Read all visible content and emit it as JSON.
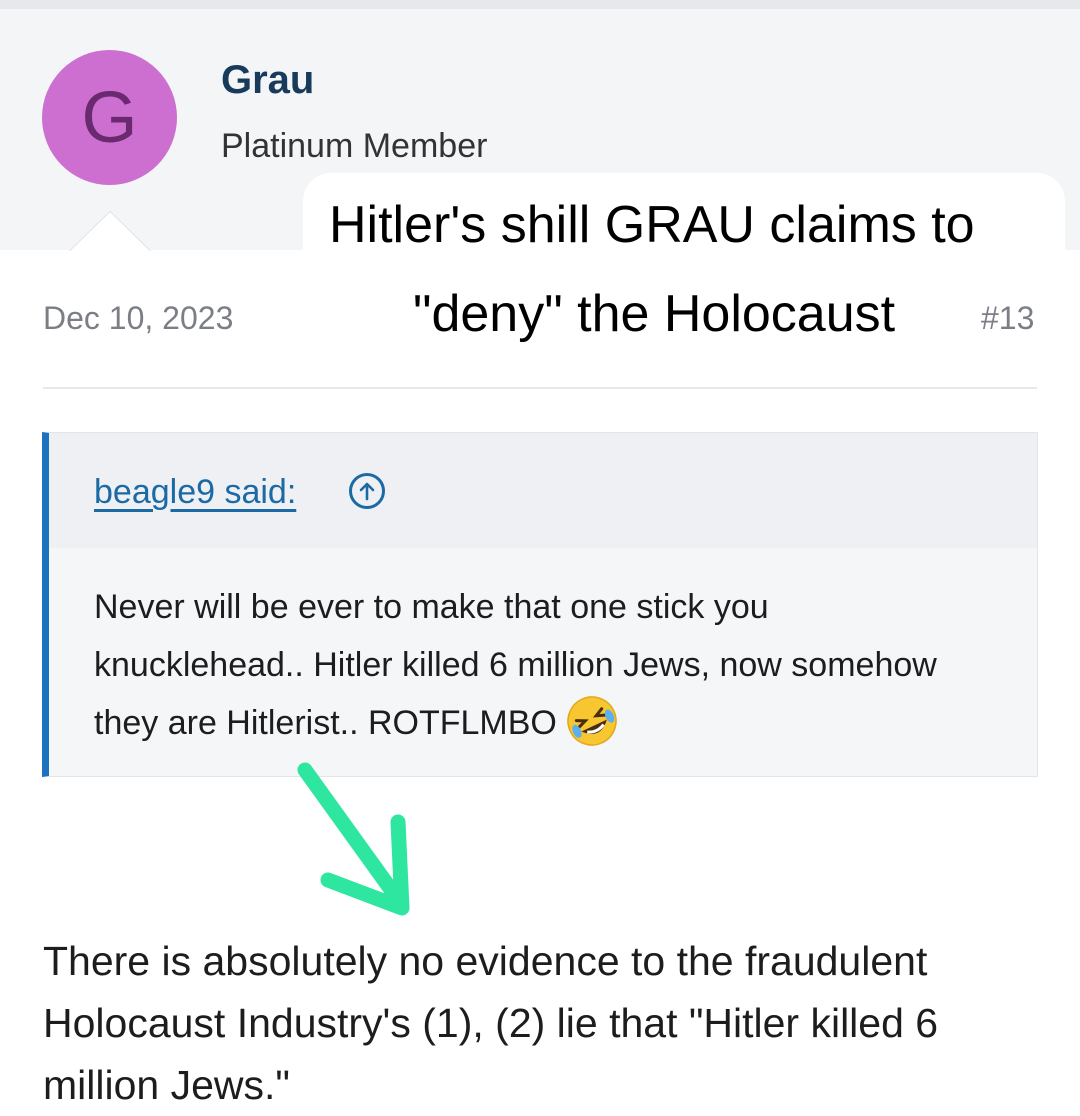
{
  "user": {
    "avatar_letter": "G",
    "name": "Grau",
    "title": "Platinum Member"
  },
  "caption": {
    "line1": "Hitler's shill GRAU claims to",
    "line2": "\"deny\" the Holocaust"
  },
  "post": {
    "date": "Dec 10, 2023",
    "number": "#13",
    "quote": {
      "author_label": "beagle9 said:",
      "text": "Never will be ever to make that one stick you knucklehead.. Hitler killed 6 million Jews, now somehow they are Hitlerist.. ROTFLMBO",
      "emoji": "rolling-on-floor-laughing-emoji"
    },
    "body": "There is absolutely no evidence to the fraudulent Holocaust Industry's (1), (2) lie that \"Hitler killed 6 million Jews.\""
  },
  "colors": {
    "header_bg": "#f4f5f7",
    "avatar_bg": "#cc6fd0",
    "username": "#183b5c",
    "quote_accent": "#1b73c0",
    "link": "#1b6aa5",
    "annotation_arrow": "#2ee6a0"
  },
  "icons": {
    "quote_jump": "arrow-up-circle-icon",
    "annotation": "arrow-down-right-icon"
  }
}
